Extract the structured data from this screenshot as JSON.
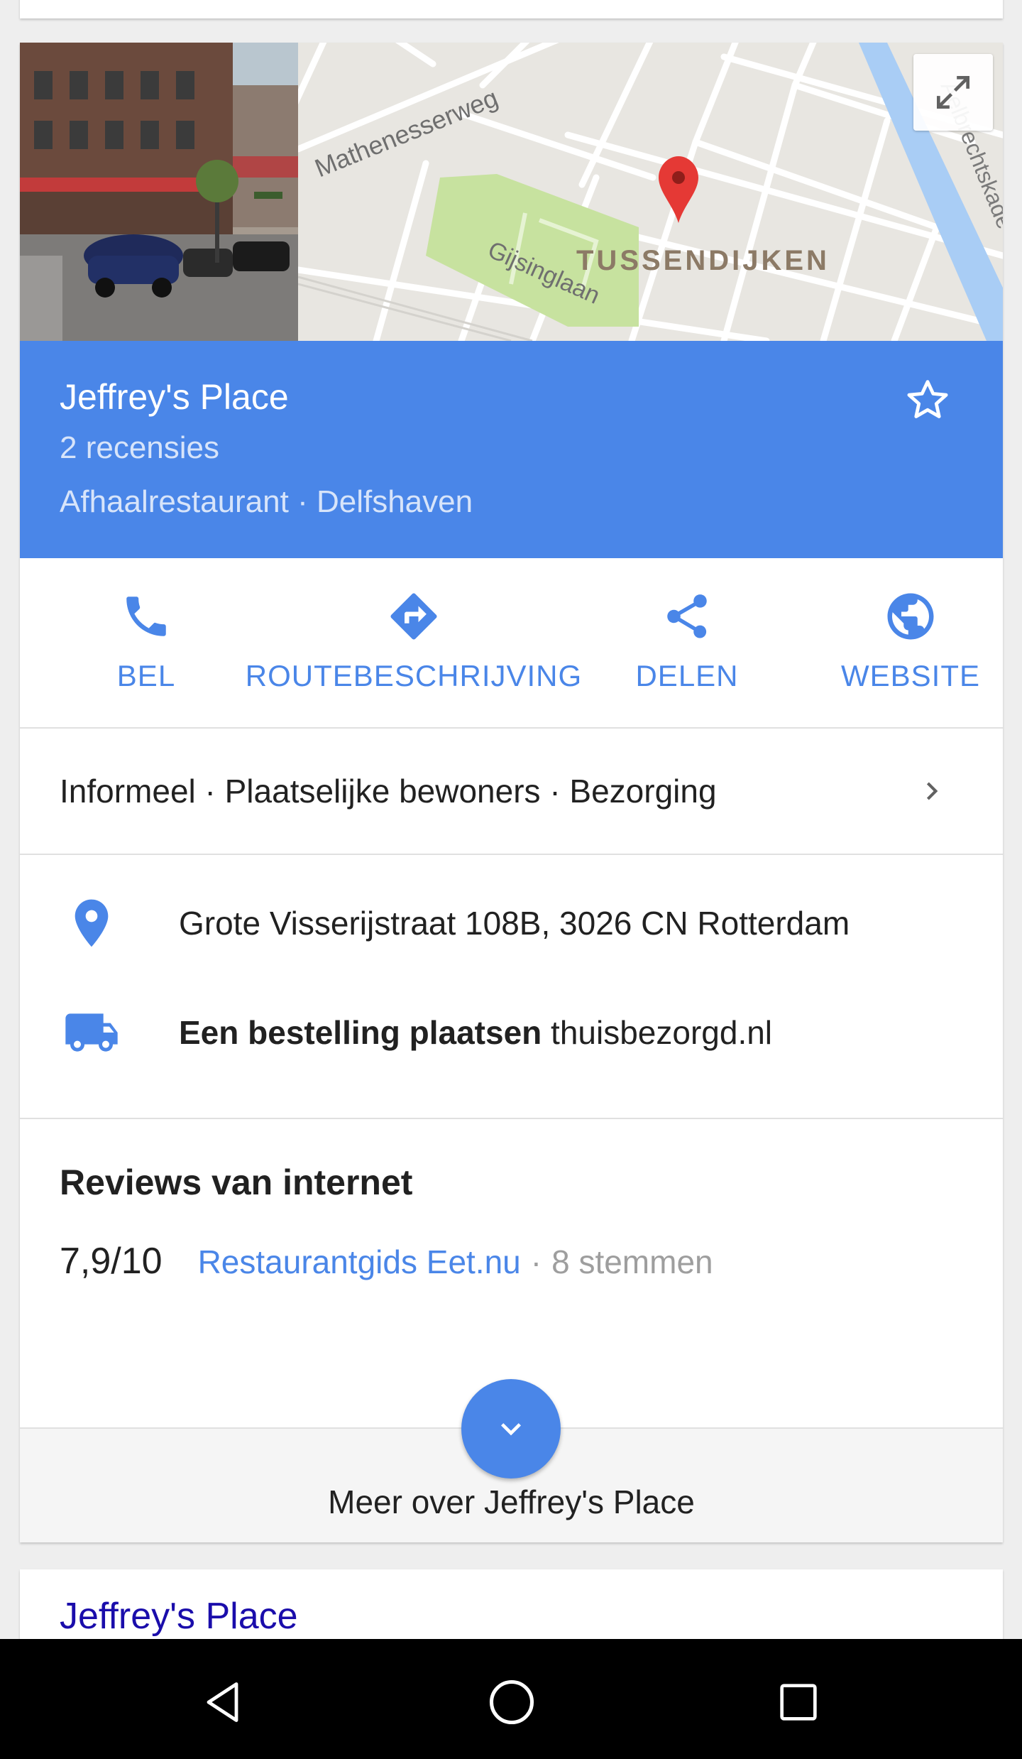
{
  "map": {
    "labels": {
      "street1": "Mathenesserweg",
      "street2": "Gijsinglaan",
      "district": "TUSSENDIJKEN",
      "quay": "Aelbrechtskade"
    }
  },
  "place": {
    "title": "Jeffrey's Place",
    "reviews": "2 recensies",
    "category": "Afhaalrestaurant · Delfshaven"
  },
  "actions": [
    {
      "label": "BEL",
      "icon": "phone-icon"
    },
    {
      "label": "ROUTEBESCHRIJVING",
      "icon": "directions-icon"
    },
    {
      "label": "DELEN",
      "icon": "share-icon"
    },
    {
      "label": "WEBSITE",
      "icon": "globe-icon"
    }
  ],
  "attributes": "Informeel · Plaatselijke bewoners · Bezorging",
  "info": {
    "address": "Grote Visserijstraat 108B, 3026 CN Rotterdam",
    "order_label": "Een bestelling plaatsen",
    "order_site": "thuisbezorgd.nl"
  },
  "reviews": {
    "title": "Reviews van internet",
    "score": "7,9/10",
    "source": "Restaurantgids Eet.nu",
    "separator": "·",
    "votes": "8 stemmen"
  },
  "more": {
    "label": "Meer over Jeffrey's Place"
  },
  "next_result": {
    "title": "Jeffrey's Place"
  },
  "colors": {
    "accent": "#4a86e8",
    "map_marker": "#e53935",
    "link": "#1a0dab"
  }
}
